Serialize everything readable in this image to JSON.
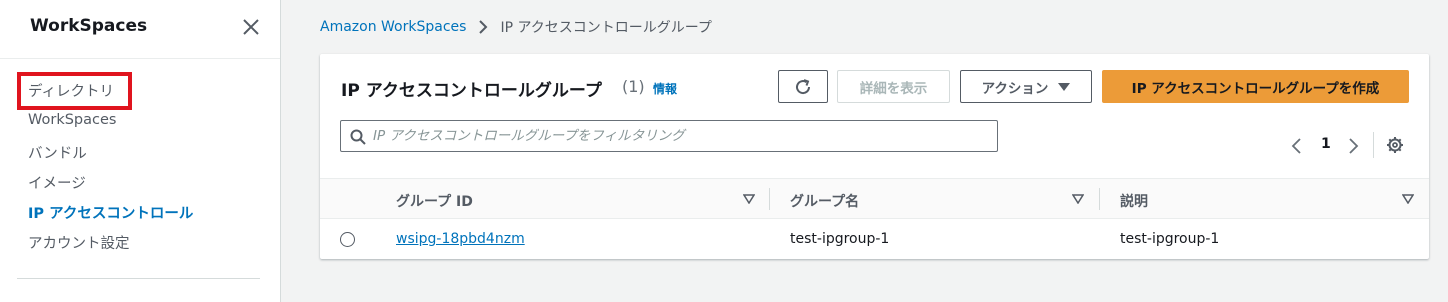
{
  "sidebar": {
    "title": "WorkSpaces",
    "items": [
      {
        "label": "ディレクトリ"
      },
      {
        "label": "WorkSpaces"
      },
      {
        "label": "バンドル"
      },
      {
        "label": "イメージ"
      },
      {
        "label": "IP アクセスコントロール",
        "active": true
      },
      {
        "label": "アカウント設定"
      }
    ]
  },
  "breadcrumb": {
    "root": "Amazon WorkSpaces",
    "current": "IP アクセスコントロールグループ"
  },
  "panel": {
    "title": "IP アクセスコントロールグループ",
    "count": "(1)",
    "info": "情報",
    "buttons": {
      "details": "詳細を表示",
      "actions": "アクション",
      "create": "IP アクセスコントロールグループを作成"
    },
    "search": {
      "placeholder": "IP アクセスコントロールグループをフィルタリング",
      "value": ""
    },
    "pagination": {
      "page": "1"
    }
  },
  "table": {
    "columns": [
      "グループ ID",
      "グループ名",
      "説明"
    ],
    "rows": [
      {
        "id": "wsipg-18pbd4nzm",
        "name": "test-ipgroup-1",
        "description": "test-ipgroup-1"
      }
    ]
  },
  "colors": {
    "accent_link": "#0073bb",
    "primary_button": "#ec9b38",
    "highlight_box": "#e0141e"
  },
  "icons": [
    "close-icon",
    "chevron-right-icon",
    "refresh-icon",
    "caret-down-icon",
    "search-icon",
    "chevron-left-icon",
    "settings-icon",
    "sort-icon"
  ]
}
